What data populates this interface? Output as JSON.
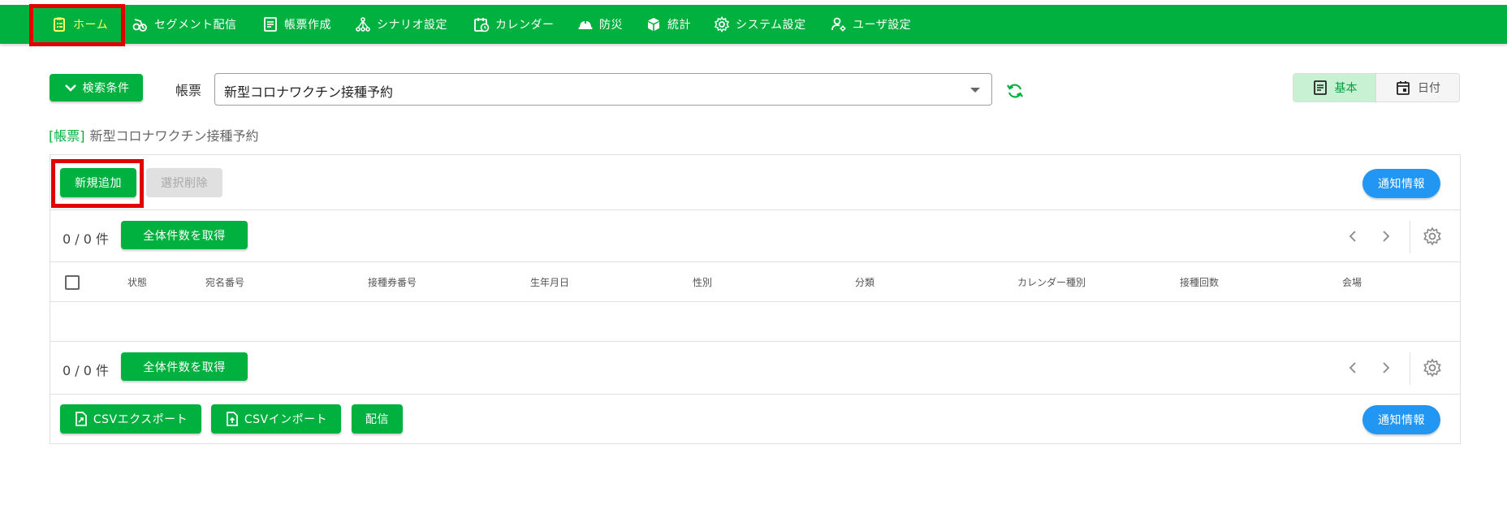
{
  "nav": {
    "items": [
      {
        "label": "ホーム",
        "icon": "clipboard-icon"
      },
      {
        "label": "セグメント配信",
        "icon": "bike-icon"
      },
      {
        "label": "帳票作成",
        "icon": "document-icon"
      },
      {
        "label": "シナリオ設定",
        "icon": "scenario-icon"
      },
      {
        "label": "カレンダー",
        "icon": "calendar-clock-icon"
      },
      {
        "label": "防災",
        "icon": "helmet-icon"
      },
      {
        "label": "統計",
        "icon": "cube-icon"
      },
      {
        "label": "システム設定",
        "icon": "gear-icon"
      },
      {
        "label": "ユーザ設定",
        "icon": "user-gear-icon"
      }
    ]
  },
  "search": {
    "toggle_label": "検索条件",
    "form_label": "帳票",
    "form_value": "新型コロナワクチン接種予約"
  },
  "view_toggle": {
    "basic": "基本",
    "date": "日付"
  },
  "breadcrumb": {
    "tag": "[帳票]",
    "name": "新型コロナワクチン接種予約"
  },
  "toolbar": {
    "add": "新規追加",
    "delete_selected": "選択削除",
    "notify": "通知情報"
  },
  "pagination": {
    "count": "0 / 0 件",
    "get_total": "全体件数を取得"
  },
  "table": {
    "headers": [
      "状態",
      "宛名番号",
      "接種券番号",
      "生年月日",
      "性別",
      "分類",
      "カレンダー種別",
      "接種回数",
      "会場"
    ]
  },
  "footer": {
    "csv_export": "CSVエクスポート",
    "csv_import": "CSVインポート",
    "deliver": "配信",
    "notify": "通知情報"
  },
  "colors": {
    "brand": "#00b140",
    "accent_blue": "#2196f3",
    "highlight": "#e00000",
    "active_nav": "#ffff66"
  }
}
